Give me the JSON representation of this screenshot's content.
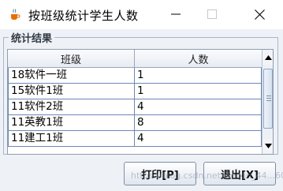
{
  "window": {
    "title": "按班级统计学生人数",
    "icon": "java-cup-icon"
  },
  "group": {
    "title": "统计结果"
  },
  "table": {
    "columns": [
      "班级",
      "人数"
    ],
    "rows": [
      [
        "18软件一班",
        "1"
      ],
      [
        "15软件1班",
        "1"
      ],
      [
        "11软件2班",
        "4"
      ],
      [
        "11英教1班",
        "8"
      ],
      [
        "11建工1班",
        "4"
      ]
    ]
  },
  "buttons": {
    "print_label": "打印[P]",
    "exit_label": "退出[X]"
  },
  "watermark": "https://blog.csdn.net/weixin_44...60",
  "colors": {
    "panel_bg": "#eef2f7",
    "grid_line": "#6f86b5",
    "group_border": "#a9b7c9"
  }
}
